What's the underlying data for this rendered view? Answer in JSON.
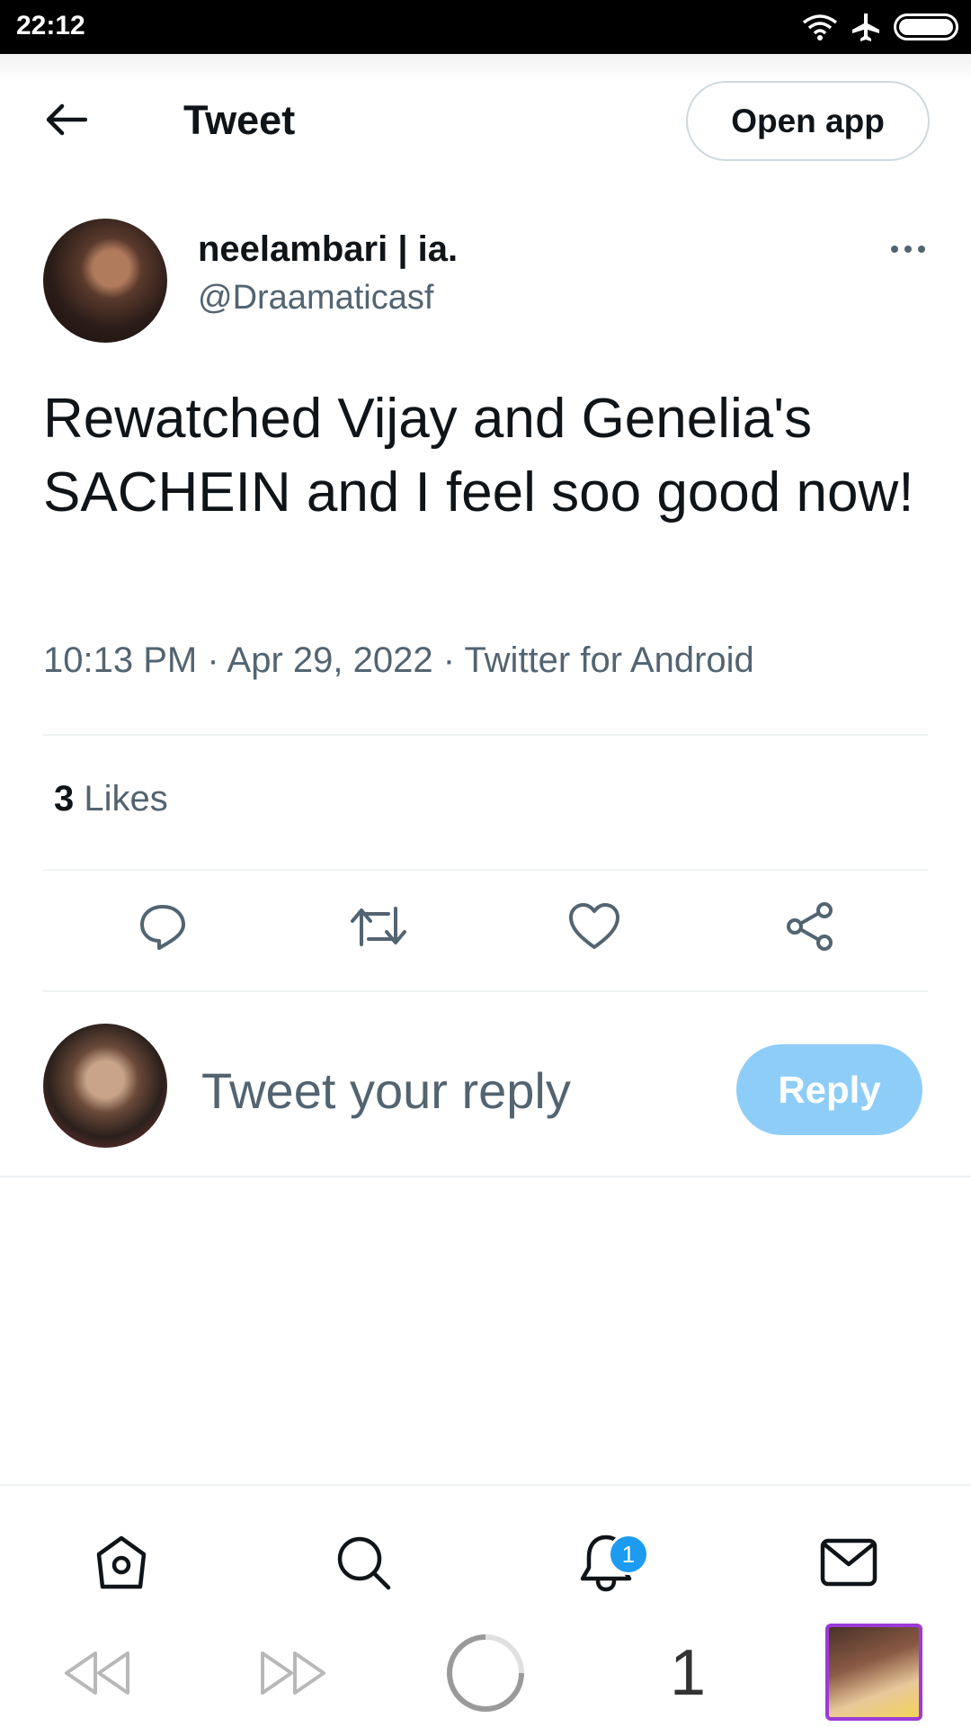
{
  "status_bar": {
    "time": "22:12",
    "icons": [
      "wifi-icon",
      "airplane-icon",
      "battery-icon"
    ]
  },
  "header": {
    "title": "Tweet",
    "open_app_label": "Open app"
  },
  "tweet": {
    "author_name": "neelambari | ia.",
    "author_handle": "@Draamaticasf",
    "text": "Rewatched Vijay and Genelia's SACHEIN and I feel soo good now!",
    "meta": "10:13 PM · Apr 29, 2022 · Twitter for Android",
    "likes_count": "3",
    "likes_label": "Likes"
  },
  "reply": {
    "placeholder": "Tweet your reply",
    "button_label": "Reply"
  },
  "bottom_nav": {
    "items": [
      "home-icon",
      "search-icon",
      "notifications-icon",
      "messages-icon"
    ],
    "notification_badge": "1"
  },
  "system_bar": {
    "page_count": "1"
  },
  "colors": {
    "text_primary": "#0f1419",
    "text_secondary": "#536471",
    "accent": "#1d9bf0",
    "reply_disabled": "#8ecdf8",
    "divider": "#eff3f4"
  }
}
